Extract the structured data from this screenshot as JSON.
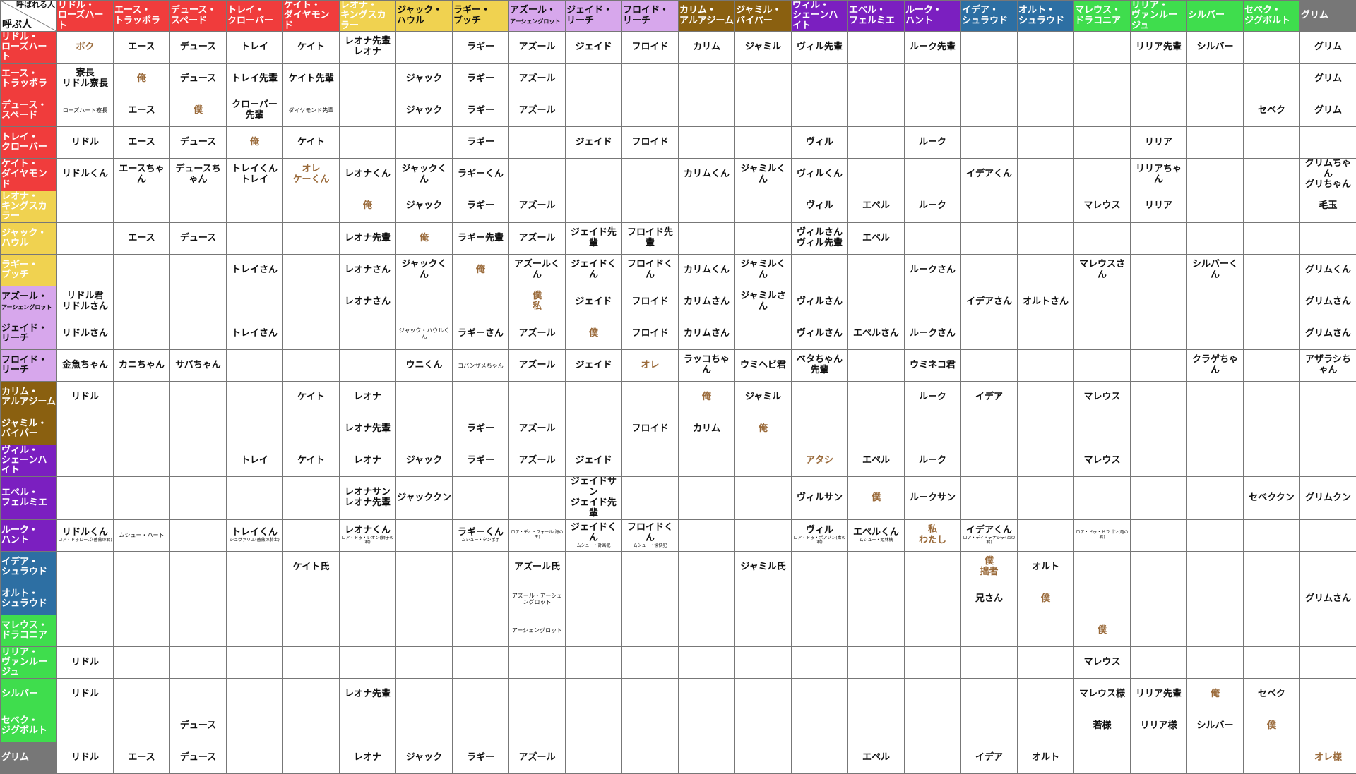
{
  "corner": {
    "called": "呼ばれる人",
    "caller": "呼ぶ人"
  },
  "colors": {
    "rose": "#f03c3c",
    "savanna": "#f0d250",
    "octa": "#d7a7ec",
    "scarabia": "#8a6010",
    "pomefiore": "#7b1fc0",
    "ignihyde": "#2d6fa3",
    "diasomnia": "#3fdd4d",
    "grim": "#777777",
    "self_text": "#9a6a3a"
  },
  "columns": [
    {
      "l1": "リドル・",
      "l2": "ローズハート",
      "color": "rose",
      "text": "#fff"
    },
    {
      "l1": "エース・",
      "l2": "トラッポラ",
      "color": "rose",
      "text": "#fff"
    },
    {
      "l1": "デュース・",
      "l2": "スペード",
      "color": "rose",
      "text": "#fff"
    },
    {
      "l1": "トレイ・",
      "l2": "クローバー",
      "color": "rose",
      "text": "#fff"
    },
    {
      "l1": "ケイト・",
      "l2": "ダイヤモンド",
      "color": "rose",
      "text": "#fff"
    },
    {
      "l1": "レオナ・",
      "l2": "キングスカラー",
      "color": "savanna",
      "text": "#fff"
    },
    {
      "l1": "ジャック・",
      "l2": "ハウル",
      "color": "savanna",
      "text": "#111"
    },
    {
      "l1": "ラギー・",
      "l2": "ブッチ",
      "color": "savanna",
      "text": "#111"
    },
    {
      "l1": "アズール・",
      "l2": "アーシェングロット",
      "color": "octa",
      "text": "#111",
      "small": true
    },
    {
      "l1": "ジェイド・",
      "l2": "リーチ",
      "color": "octa",
      "text": "#111"
    },
    {
      "l1": "フロイド・",
      "l2": "リーチ",
      "color": "octa",
      "text": "#111"
    },
    {
      "l1": "カリム・",
      "l2": "アルアジーム",
      "color": "scarabia",
      "text": "#fff"
    },
    {
      "l1": "ジャミル・",
      "l2": "バイパー",
      "color": "scarabia",
      "text": "#fff"
    },
    {
      "l1": "ヴィル・",
      "l2": "シェーンハイト",
      "color": "pomefiore",
      "text": "#fff"
    },
    {
      "l1": "エペル・",
      "l2": "フェルミエ",
      "color": "pomefiore",
      "text": "#fff"
    },
    {
      "l1": "ルーク・",
      "l2": "ハント",
      "color": "pomefiore",
      "text": "#fff"
    },
    {
      "l1": "イデア・",
      "l2": "シュラウド",
      "color": "ignihyde",
      "text": "#fff"
    },
    {
      "l1": "オルト・",
      "l2": "シュラウド",
      "color": "ignihyde",
      "text": "#fff"
    },
    {
      "l1": "マレウス・",
      "l2": "ドラコニア",
      "color": "diasomnia",
      "text": "#fff"
    },
    {
      "l1": "リリア・",
      "l2": "ヴァンルージュ",
      "color": "diasomnia",
      "text": "#fff"
    },
    {
      "l1": "シルバー",
      "l2": "",
      "color": "diasomnia",
      "text": "#fff"
    },
    {
      "l1": "セベク・",
      "l2": "ジグボルト",
      "color": "diasomnia",
      "text": "#fff"
    },
    {
      "l1": "グリム",
      "l2": "",
      "color": "grim",
      "text": "#fff"
    }
  ],
  "rows": [
    {
      "l1": "リドル・",
      "l2": "ローズハート",
      "color": "rose",
      "text": "#fff",
      "cells": [
        "ボク",
        "エース",
        "デュース",
        "トレイ",
        "ケイト",
        "レオナ先輩\nレオナ",
        "",
        "ラギー",
        "アズール",
        "ジェイド",
        "フロイド",
        "カリム",
        "ジャミル",
        "ヴィル先輩",
        "",
        "ルーク先輩",
        "",
        "",
        "",
        "リリア先輩",
        "シルバー",
        "",
        "グリム"
      ]
    },
    {
      "l1": "エース・",
      "l2": "トラッポラ",
      "color": "rose",
      "text": "#fff",
      "cells": [
        "寮長\nリドル寮長",
        "俺",
        "デュース",
        "トレイ先輩",
        "ケイト先輩",
        "",
        "ジャック",
        "ラギー",
        "アズール",
        "",
        "",
        "",
        "",
        "",
        "",
        "",
        "",
        "",
        "",
        "",
        "",
        "",
        "グリム"
      ]
    },
    {
      "l1": "デュース・",
      "l2": "スペード",
      "color": "rose",
      "text": "#fff",
      "cells": [
        "ローズハート寮長",
        "エース",
        "僕",
        "クローバー先輩",
        "ダイヤモンド先輩",
        "",
        "ジャック",
        "ラギー",
        "アズール",
        "",
        "",
        "",
        "",
        "",
        "",
        "",
        "",
        "",
        "",
        "",
        "",
        "セベク",
        "グリム"
      ]
    },
    {
      "l1": "トレイ・",
      "l2": "クローバー",
      "color": "rose",
      "text": "#fff",
      "cells": [
        "リドル",
        "エース",
        "デュース",
        "俺",
        "ケイト",
        "",
        "",
        "ラギー",
        "",
        "ジェイド",
        "フロイド",
        "",
        "",
        "ヴィル",
        "",
        "ルーク",
        "",
        "",
        "",
        "リリア",
        "",
        "",
        ""
      ]
    },
    {
      "l1": "ケイト・",
      "l2": "ダイヤモンド",
      "color": "rose",
      "text": "#fff",
      "cells": [
        "リドルくん",
        "エースちゃん",
        "デュースちゃん",
        "トレイくん\nトレイ",
        "オレ\nケーくん",
        "レオナくん",
        "ジャックくん",
        "ラギーくん",
        "",
        "",
        "",
        "カリムくん",
        "ジャミルくん",
        "ヴィルくん",
        "",
        "",
        "イデアくん",
        "",
        "",
        "リリアちゃん",
        "",
        "",
        "グリムちゃん\nグリちゃん"
      ]
    },
    {
      "l1": "レオナ・",
      "l2": "キングスカラー",
      "color": "savanna",
      "text": "#fff",
      "cells": [
        "",
        "",
        "",
        "",
        "",
        "俺",
        "ジャック",
        "ラギー",
        "アズール",
        "",
        "",
        "",
        "",
        "ヴィル",
        "エペル",
        "ルーク",
        "",
        "",
        "マレウス",
        "リリア",
        "",
        "",
        "毛玉"
      ]
    },
    {
      "l1": "ジャック・",
      "l2": "ハウル",
      "color": "savanna",
      "text": "#fff",
      "cells": [
        "",
        "エース",
        "デュース",
        "",
        "",
        "レオナ先輩",
        "俺",
        "ラギー先輩",
        "アズール",
        "ジェイド先輩",
        "フロイド先輩",
        "",
        "",
        "ヴィルさん\nヴィル先輩",
        "エペル",
        "",
        "",
        "",
        "",
        "",
        "",
        "",
        ""
      ]
    },
    {
      "l1": "ラギー・",
      "l2": "ブッチ",
      "color": "savanna",
      "text": "#fff",
      "cells": [
        "",
        "",
        "",
        "トレイさん",
        "",
        "レオナさん",
        "ジャックくん",
        "俺",
        "アズールくん",
        "ジェイドくん",
        "フロイドくん",
        "カリムくん",
        "ジャミルくん",
        "",
        "",
        "ルークさん",
        "",
        "",
        "マレウスさん",
        "",
        "シルバーくん",
        "",
        "グリムくん"
      ]
    },
    {
      "l1": "アズール・",
      "l2": "アーシェングロット",
      "color": "octa",
      "text": "#111",
      "small": true,
      "cells": [
        "リドル君\nリドルさん",
        "",
        "",
        "",
        "",
        "レオナさん",
        "",
        "",
        "僕\n私",
        "ジェイド",
        "フロイド",
        "カリムさん",
        "ジャミルさん",
        "ヴィルさん",
        "",
        "",
        "イデアさん",
        "オルトさん",
        "",
        "",
        "",
        "",
        "グリムさん"
      ]
    },
    {
      "l1": "ジェイド・",
      "l2": "リーチ",
      "color": "octa",
      "text": "#111",
      "cells": [
        "リドルさん",
        "",
        "",
        "トレイさん",
        "",
        "",
        "ジャック・ハウルくん",
        "ラギーさん",
        "アズール",
        "僕",
        "フロイド",
        "カリムさん",
        "",
        "ヴィルさん",
        "エペルさん",
        "ルークさん",
        "",
        "",
        "",
        "",
        "",
        "",
        "グリムさん"
      ]
    },
    {
      "l1": "フロイド・",
      "l2": "リーチ",
      "color": "octa",
      "text": "#111",
      "cells": [
        "金魚ちゃん",
        "カニちゃん",
        "サバちゃん",
        "",
        "",
        "",
        "ウニくん",
        "コバンザメちゃん",
        "アズール",
        "ジェイド",
        "オレ",
        "ラッコちゃん",
        "ウミヘビ君",
        "ベタちゃん先輩",
        "",
        "ウミネコ君",
        "",
        "",
        "",
        "",
        "クラゲちゃん",
        "",
        "アザラシちゃん"
      ]
    },
    {
      "l1": "カリム・",
      "l2": "アルアジーム",
      "color": "scarabia",
      "text": "#fff",
      "cells": [
        "リドル",
        "",
        "",
        "",
        "ケイト",
        "レオナ",
        "",
        "",
        "",
        "",
        "",
        "俺",
        "ジャミル",
        "",
        "",
        "ルーク",
        "イデア",
        "",
        "マレウス",
        "",
        "",
        "",
        ""
      ]
    },
    {
      "l1": "ジャミル・",
      "l2": "バイパー",
      "color": "scarabia",
      "text": "#fff",
      "cells": [
        "",
        "",
        "",
        "",
        "",
        "レオナ先輩",
        "",
        "ラギー",
        "アズール",
        "",
        "フロイド",
        "カリム",
        "俺",
        "",
        "",
        "",
        "",
        "",
        "",
        "",
        "",
        "",
        ""
      ]
    },
    {
      "l1": "ヴィル・",
      "l2": "シェーンハイト",
      "color": "pomefiore",
      "text": "#fff",
      "cells": [
        "",
        "",
        "",
        "トレイ",
        "ケイト",
        "レオナ",
        "ジャック",
        "ラギー",
        "アズール",
        "ジェイド",
        "",
        "",
        "",
        "アタシ",
        "エペル",
        "ルーク",
        "",
        "",
        "マレウス",
        "",
        "",
        "",
        ""
      ]
    },
    {
      "l1": "エペル・",
      "l2": "フェルミエ",
      "color": "pomefiore",
      "text": "#fff",
      "cells": [
        "",
        "",
        "",
        "",
        "",
        "レオナサン\nレオナ先輩",
        "ジャッククン",
        "",
        "",
        "ジェイドサン\nジェイド先輩",
        "",
        "",
        "",
        "ヴィルサン",
        "僕",
        "ルークサン",
        "",
        "",
        "",
        "",
        "",
        "セベククン",
        "グリムクン"
      ]
    },
    {
      "l1": "ルーク・",
      "l2": "ハント",
      "color": "pomefiore",
      "text": "#fff",
      "cells": [
        "リドルくん",
        "ムシュー・ハート",
        "",
        "トレイくん",
        "",
        "レオナくん",
        "",
        "ラギーくん",
        "",
        "ジェイドくん",
        "フロイドくん",
        "",
        "",
        "ヴィル",
        "エペルくん",
        "私\nわたし",
        "イデアくん",
        "",
        "",
        "",
        "",
        "",
        ""
      ],
      "notes": [
        "ロア・ドゥローズ(薔薇の君)",
        "",
        "",
        "シュヴァリエ(薔薇の騎士)",
        "",
        "ロア・ドゥ・レオン(獅子の君)",
        "",
        "ムシュー・タンポポ",
        "ロア・ディ・フォール(海の王)",
        "ムシュー・計画犯",
        "ムシュー・愉快犯",
        "",
        "",
        "ロア・ドゥ・ポアゾン(毒の君)",
        "ムシュー・姫林檎",
        "",
        "ロア・ディ・テナシテ(炎の君)",
        "",
        "ロア・ドゥ・ドラゴン(竜の君)",
        "",
        "",
        "",
        ""
      ]
    },
    {
      "l1": "イデア・",
      "l2": "シュラウド",
      "color": "ignihyde",
      "text": "#fff",
      "cells": [
        "",
        "",
        "",
        "",
        "ケイト氏",
        "",
        "",
        "",
        "アズール氏",
        "",
        "",
        "",
        "ジャミル氏",
        "",
        "",
        "",
        "僕\n拙者",
        "オルト",
        "",
        "",
        "",
        "",
        ""
      ]
    },
    {
      "l1": "オルト・",
      "l2": "シュラウド",
      "color": "ignihyde",
      "text": "#fff",
      "cells": [
        "",
        "",
        "",
        "",
        "",
        "",
        "",
        "",
        "アズール・アーシェングロット",
        "",
        "",
        "",
        "",
        "",
        "",
        "",
        "兄さん",
        "僕",
        "",
        "",
        "",
        "",
        "グリムさん"
      ]
    },
    {
      "l1": "マレウス・",
      "l2": "ドラコニア",
      "color": "diasomnia",
      "text": "#fff",
      "cells": [
        "",
        "",
        "",
        "",
        "",
        "",
        "",
        "",
        "アーシェングロット",
        "",
        "",
        "",
        "",
        "",
        "",
        "",
        "",
        "",
        "僕",
        "",
        "",
        "",
        ""
      ]
    },
    {
      "l1": "リリア・",
      "l2": "ヴァンルージュ",
      "color": "diasomnia",
      "text": "#fff",
      "cells": [
        "リドル",
        "",
        "",
        "",
        "",
        "",
        "",
        "",
        "",
        "",
        "",
        "",
        "",
        "",
        "",
        "",
        "",
        "",
        "マレウス",
        "",
        "",
        "",
        ""
      ]
    },
    {
      "l1": "シルバー",
      "l2": "",
      "color": "diasomnia",
      "text": "#fff",
      "cells": [
        "リドル",
        "",
        "",
        "",
        "",
        "レオナ先輩",
        "",
        "",
        "",
        "",
        "",
        "",
        "",
        "",
        "",
        "",
        "",
        "",
        "マレウス様",
        "リリア先輩",
        "俺",
        "セベク",
        ""
      ]
    },
    {
      "l1": "セベク・",
      "l2": "ジグボルト",
      "color": "diasomnia",
      "text": "#fff",
      "cells": [
        "",
        "",
        "デュース",
        "",
        "",
        "",
        "",
        "",
        "",
        "",
        "",
        "",
        "",
        "",
        "",
        "",
        "",
        "",
        "若様",
        "リリア様",
        "シルバー",
        "僕",
        ""
      ]
    },
    {
      "l1": "グリム",
      "l2": "",
      "color": "grim",
      "text": "#fff",
      "cells": [
        "リドル",
        "エース",
        "デュース",
        "",
        "",
        "レオナ",
        "ジャック",
        "ラギー",
        "アズール",
        "",
        "",
        "",
        "",
        "",
        "エペル",
        "",
        "イデア",
        "オルト",
        "",
        "",
        "",
        "",
        "オレ様"
      ]
    }
  ]
}
